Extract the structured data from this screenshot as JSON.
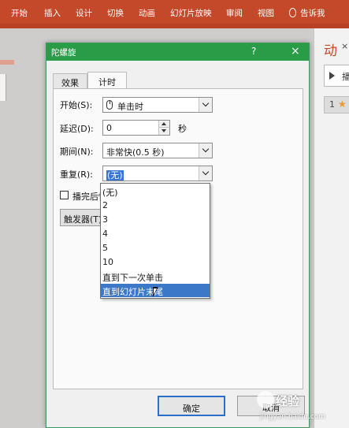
{
  "ribbon": {
    "tabs": [
      "开始",
      "插入",
      "设计",
      "切换",
      "动画",
      "幻灯片放映",
      "审阅",
      "视图"
    ],
    "tell_me": "告诉我"
  },
  "animation_pane": {
    "title": "动",
    "close": "×",
    "play_label": "播",
    "item_number": "1"
  },
  "dialog": {
    "title": "陀螺旋",
    "help": "?",
    "close": "×",
    "tabs": [
      "效果",
      "计时"
    ],
    "active_tab": "计时",
    "start": {
      "label": "开始(S):",
      "value": "单击时"
    },
    "delay": {
      "label": "延迟(D):",
      "value": "0",
      "unit": "秒"
    },
    "duration": {
      "label": "期间(N):",
      "value": "非常快(0.5 秒)"
    },
    "repeat": {
      "label": "重复(R):",
      "value": "(无)",
      "options": [
        "(无)",
        "2",
        "3",
        "4",
        "5",
        "10",
        "直到下一次单击",
        "直到幻灯片末尾"
      ],
      "highlighted": "直到幻灯片末尾"
    },
    "rewind_label": "播完后快退",
    "trigger_label": "触发器(T)",
    "ok": "确定",
    "cancel": "取消"
  },
  "watermark": {
    "brand": "经验",
    "url": "jingyan.baidu.com"
  },
  "colors": {
    "ribbon": "#c4492a",
    "titlebar": "#2a9b47",
    "selection": "#3c78c8"
  }
}
